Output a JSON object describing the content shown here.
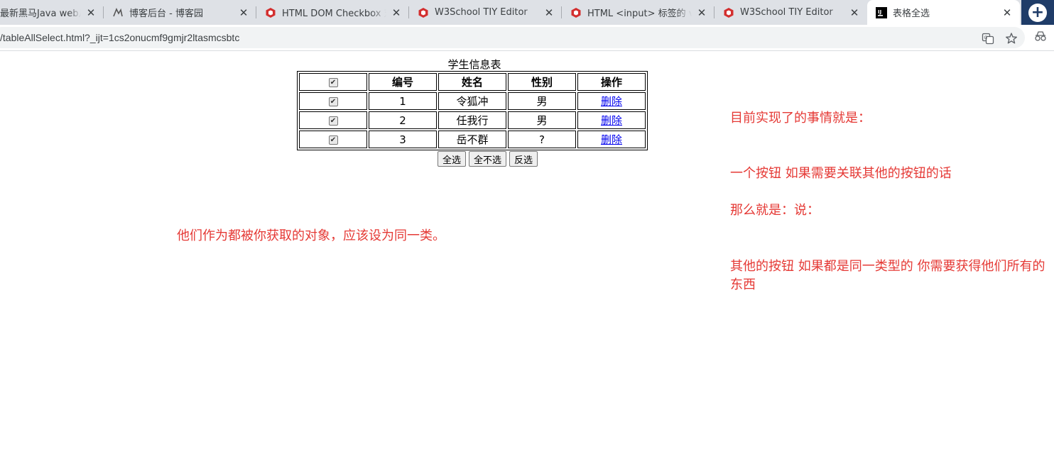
{
  "browser": {
    "tabs": [
      {
        "title": "最新黑马Java web从入门到精通",
        "icon": "generic"
      },
      {
        "title": "博客后台 - 博客园",
        "icon": "cnblogs"
      },
      {
        "title": "HTML DOM Checkbox 对象",
        "icon": "w3school"
      },
      {
        "title": "W3School TIY Editor",
        "icon": "w3school"
      },
      {
        "title": "HTML <input> 标签的 value 属性",
        "icon": "w3school"
      },
      {
        "title": "W3School TIY Editor",
        "icon": "w3school"
      },
      {
        "title": "表格全选",
        "icon": "intellij"
      }
    ],
    "active_tab": 6,
    "close_glyph": "✕",
    "new_tab_glyph": "+",
    "url": "/tableAllSelect.html?_ijt=1cs2onucmf9gmjr2ltasmcsbtc"
  },
  "page": {
    "caption": "学生信息表",
    "headers": [
      "编号",
      "姓名",
      "性别",
      "操作"
    ],
    "rows": [
      {
        "id": "1",
        "name": "令狐冲",
        "gender": "男",
        "action": "删除"
      },
      {
        "id": "2",
        "name": "任我行",
        "gender": "男",
        "action": "删除"
      },
      {
        "id": "3",
        "name": "岳不群",
        "gender": "?",
        "action": "删除"
      }
    ],
    "buttons": {
      "select_all": "全选",
      "select_none": "全不选",
      "invert": "反选"
    },
    "notes": {
      "left": "他们作为都被你获取的对象，应该设为同一类。",
      "right1": "目前实现了的事情就是：",
      "right2": "一个按钮 如果需要关联其他的按钮的话",
      "right3": "那么就是：说：",
      "right4": "其他的按钮 如果都是同一类型的 你需要获得他们所有的东西"
    }
  },
  "colors": {
    "note": "#e53935",
    "link": "#0000ee",
    "tabbar": "#dee1e6",
    "newtab": "#1f3c68"
  }
}
